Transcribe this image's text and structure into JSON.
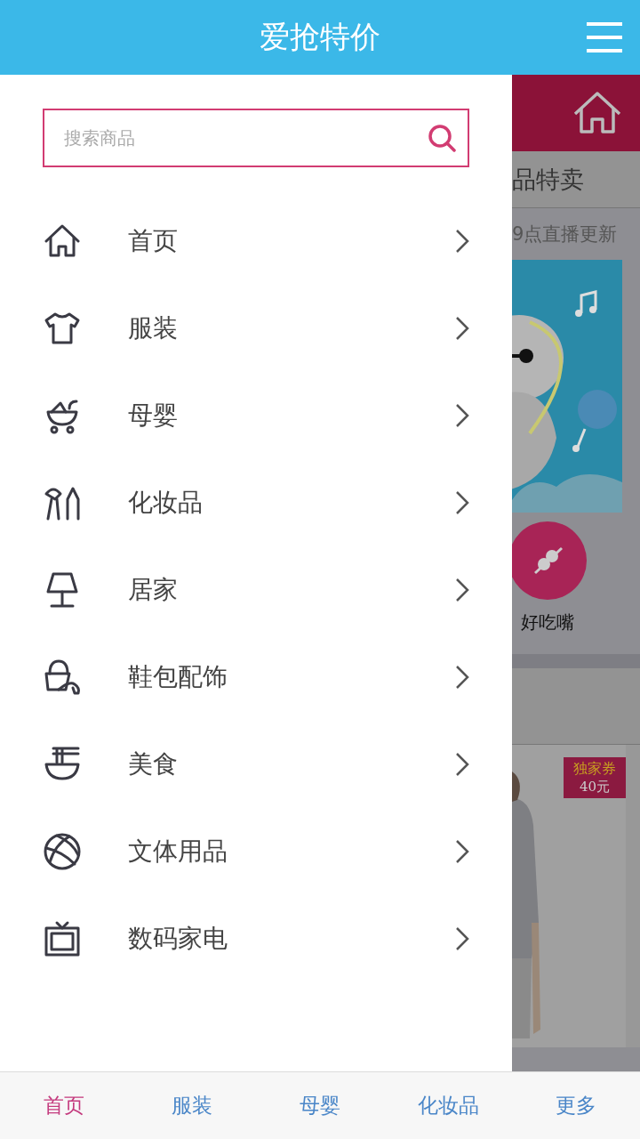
{
  "header": {
    "title": "爱抢特价"
  },
  "search": {
    "placeholder": "搜索商品"
  },
  "menu": [
    {
      "label": "首页",
      "kind": "home"
    },
    {
      "label": "服装",
      "kind": "shirt"
    },
    {
      "label": "母婴",
      "kind": "stroller"
    },
    {
      "label": "化妆品",
      "kind": "cosmetics"
    },
    {
      "label": "居家",
      "kind": "lamp"
    },
    {
      "label": "鞋包配饰",
      "kind": "bag"
    },
    {
      "label": "美食",
      "kind": "bowl"
    },
    {
      "label": "文体用品",
      "kind": "ball"
    },
    {
      "label": "数码家电",
      "kind": "tv"
    }
  ],
  "background_page": {
    "section_title": "品特卖",
    "subtitle": "9点直播更新",
    "category": {
      "label": "好吃嘴"
    },
    "badge": {
      "line1": "独家券",
      "line2": "40元"
    }
  },
  "bottom_nav": [
    {
      "label": "首页",
      "selected": true
    },
    {
      "label": "服装",
      "selected": false
    },
    {
      "label": "母婴",
      "selected": false
    },
    {
      "label": "化妆品",
      "selected": false
    },
    {
      "label": "更多",
      "selected": false
    }
  ]
}
